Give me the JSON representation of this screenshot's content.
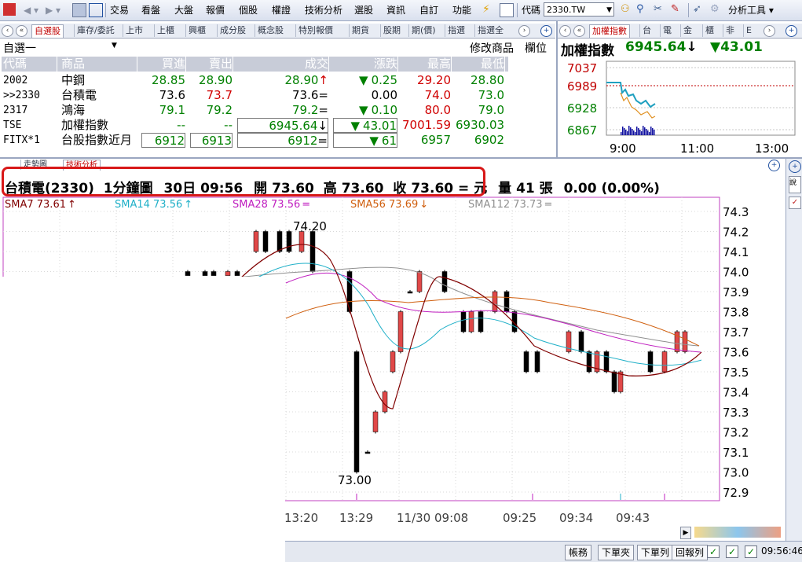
{
  "toolbar": {
    "items": [
      "交易",
      "看盤",
      "大盤",
      "報價",
      "個股",
      "權證",
      "技術分析",
      "選股",
      "資訊",
      "自訂",
      "功能"
    ],
    "code_label": "代碼",
    "code_value": "2330.TW",
    "analysis_tools": "分析工具"
  },
  "left_tabs": [
    "自選股",
    "庫存/委託",
    "上市",
    "上櫃",
    "興櫃",
    "成分股",
    "概念股",
    "特別報價",
    "期貨",
    "股期",
    "期(價)",
    "指選",
    "指選全"
  ],
  "watchlist": {
    "name": "自選一",
    "modify_label": "修改商品",
    "column_label": "欄位"
  },
  "quote_headers": [
    "代碼",
    "商品",
    "買進",
    "賣出",
    "成交",
    "漲跌",
    "最高",
    "最低"
  ],
  "quote_rows": [
    {
      "code": "2002",
      "name": "中鋼",
      "bid": "28.85",
      "ask": "28.90",
      "last": "28.90",
      "last_mark": "↑",
      "change": "0.25",
      "change_mark": "▼",
      "high": "29.20",
      "low": "28.80"
    },
    {
      "code": ">>2330",
      "name": "台積電",
      "bid": "73.6",
      "ask": "73.7",
      "last": "73.6",
      "last_mark": "=",
      "change": "0.00",
      "change_mark": "",
      "high": "74.0",
      "low": "73.0"
    },
    {
      "code": "2317",
      "name": "鴻海",
      "bid": "79.1",
      "ask": "79.2",
      "last": "79.2",
      "last_mark": "=",
      "change": "0.10",
      "change_mark": "▼",
      "high": "80.0",
      "low": "79.0"
    },
    {
      "code": "TSE",
      "name": "加權指數",
      "bid": "--",
      "ask": "--",
      "last": "6945.64",
      "last_mark": "↓",
      "change": "43.01",
      "change_mark": "▼",
      "high": "7001.59",
      "low": "6930.03"
    },
    {
      "code": "FITX*1",
      "name": "台股指數近月",
      "bid": "6912",
      "ask": "6913",
      "last": "6912",
      "last_mark": "=",
      "change": "61",
      "change_mark": "▼",
      "high": "6957",
      "low": "6902"
    }
  ],
  "index_panel": {
    "tabs": [
      "加權指數",
      "台",
      "電",
      "金",
      "櫃",
      "非",
      "E"
    ],
    "title": "加權指數",
    "value": "6945.64",
    "value_mark": "↓",
    "change": "▼43.01",
    "y_ticks": [
      "7037",
      "6989",
      "6928",
      "6867"
    ],
    "x_ticks": [
      "9:00",
      "11:00",
      "13:00"
    ]
  },
  "chart_tabs": [
    "走勢圖",
    "技術分析"
  ],
  "chart_header": {
    "name": "台積電(2330)",
    "period": "1分鐘圖",
    "date": "30日 09:56",
    "open_label": "開",
    "open": "73.60",
    "high_label": "高",
    "high": "73.60",
    "close_label": "收",
    "close": "73.60",
    "close_unit": "= 元",
    "vol_label": "量",
    "vol": "41",
    "vol_unit": "張",
    "change": "0.00 (0.00%)"
  },
  "sma_legend": [
    {
      "label": "SMA7 73.61",
      "mark": "↑",
      "color": "#800000"
    },
    {
      "label": "SMA14 73.56",
      "mark": "↑",
      "color": "#20b0c8"
    },
    {
      "label": "SMA28 73.56",
      "mark": "=",
      "color": "#c020c0"
    },
    {
      "label": "SMA56 73.69",
      "mark": "↓",
      "color": "#d06010"
    },
    {
      "label": "SMA112 73.73",
      "mark": "=",
      "color": "#909090"
    }
  ],
  "chart_data": {
    "type": "candlestick",
    "y_ticks": [
      "74.3",
      "74.2",
      "74.1",
      "74.0",
      "73.9",
      "73.8",
      "73.7",
      "73.6",
      "73.5",
      "73.4",
      "73.3",
      "73.2",
      "73.1",
      "73.0",
      "72.9"
    ],
    "ylim": [
      72.9,
      74.3
    ],
    "x_ticks": [
      "13:20",
      "13:29",
      "11/30 09:08",
      "09:25",
      "09:34",
      "09:43"
    ],
    "annotations": [
      "74.20",
      "73.00"
    ],
    "colors": {
      "up": "#e04848",
      "down": "#000000"
    }
  },
  "status": {
    "buttons": [
      "帳務",
      "下單夾",
      "下單列",
      "回報列"
    ],
    "time": "09:56:46"
  }
}
